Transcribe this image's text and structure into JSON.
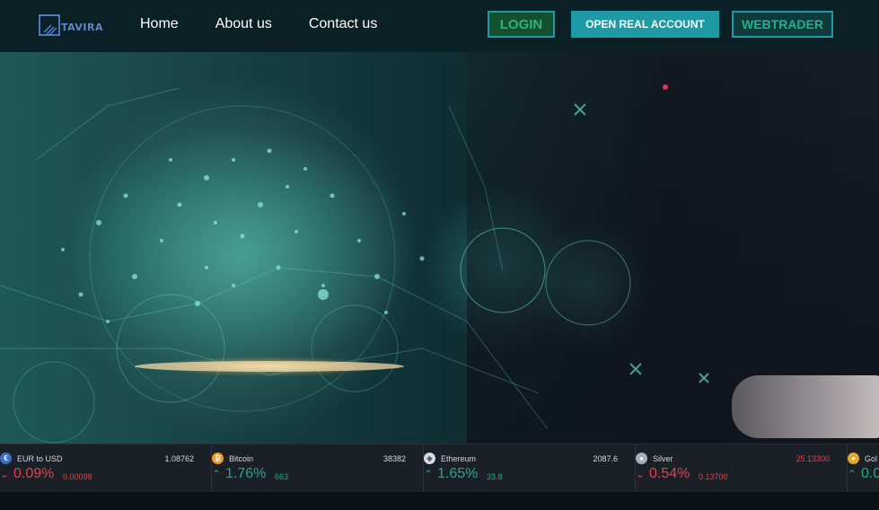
{
  "header": {
    "logo_text": "TAVIRA",
    "nav": [
      "Home",
      "About us",
      "Contact us"
    ],
    "buttons": {
      "login": "LOGIN",
      "open_real_account": "OPEN REAL ACCOUNT",
      "webtrader": "WEBTRADER"
    }
  },
  "colors": {
    "accent": "#1e9aa5",
    "up": "#1fa98a",
    "down": "#e2414a"
  },
  "ticker": [
    {
      "name": "EUR to USD",
      "price": "1.08762",
      "pct": "0.09%",
      "change": "0.00098",
      "direction": "down",
      "icon": "eur-usd-icon"
    },
    {
      "name": "Bitcoin",
      "price": "38382",
      "pct": "1.76%",
      "change": "663",
      "direction": "up",
      "icon": "bitcoin-icon"
    },
    {
      "name": "Ethereum",
      "price": "2087.6",
      "pct": "1.65%",
      "change": "33.8",
      "direction": "up",
      "icon": "ethereum-icon"
    },
    {
      "name": "Silver",
      "price": "25.13300",
      "pct": "0.54%",
      "change": "0.13700",
      "direction": "down",
      "icon": "silver-icon"
    },
    {
      "name": "Gol",
      "price": "",
      "pct": "0.0",
      "change": "",
      "direction": "up",
      "icon": "gold-icon"
    }
  ]
}
